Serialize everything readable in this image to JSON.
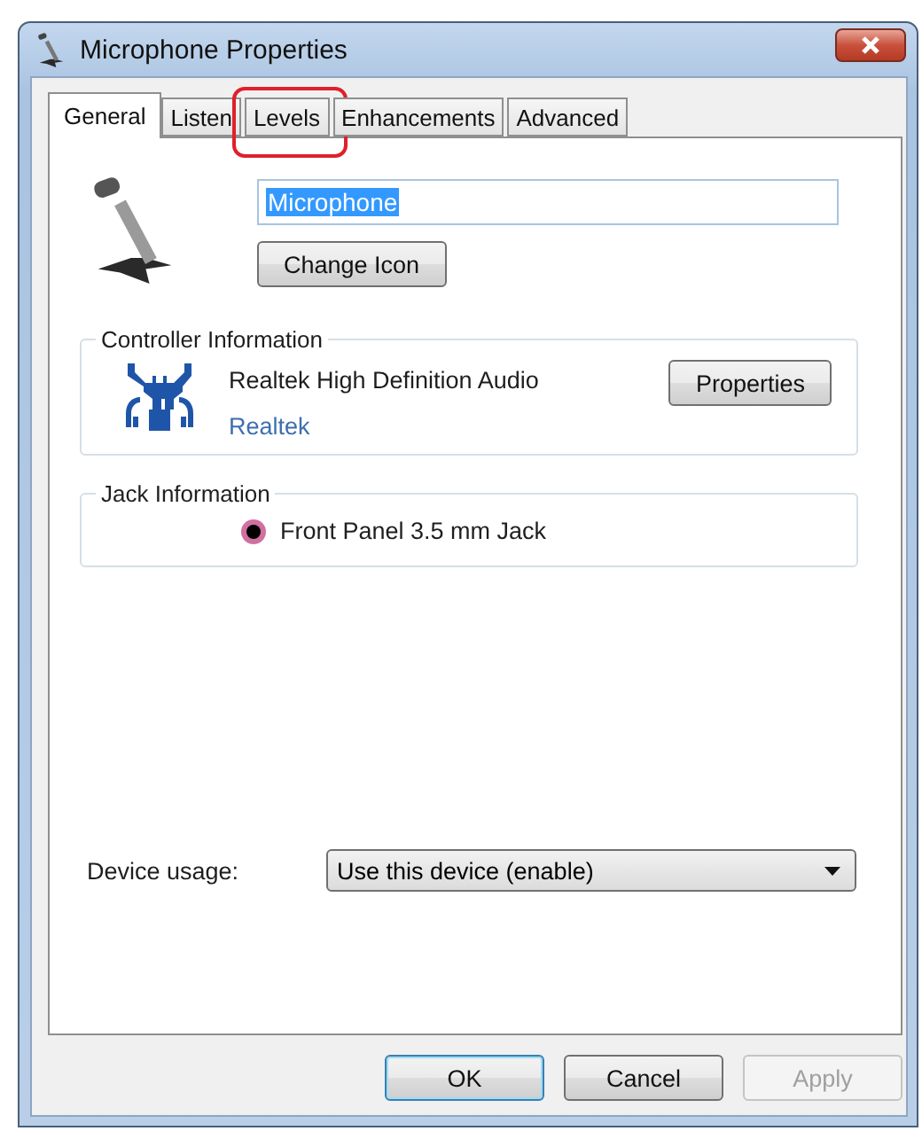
{
  "window": {
    "title": "Microphone Properties"
  },
  "tabs": [
    {
      "label": "General",
      "selected": true,
      "annotated": false
    },
    {
      "label": "Listen",
      "selected": false,
      "annotated": false
    },
    {
      "label": "Levels",
      "selected": false,
      "annotated": true
    },
    {
      "label": "Enhancements",
      "selected": false,
      "annotated": false
    },
    {
      "label": "Advanced",
      "selected": false,
      "annotated": false
    }
  ],
  "device": {
    "name": "Microphone",
    "text_selected": true,
    "change_icon_button": "Change Icon"
  },
  "controller": {
    "legend": "Controller Information",
    "name": "Realtek High Definition Audio",
    "vendor_link": "Realtek",
    "properties_button": "Properties"
  },
  "jack": {
    "legend": "Jack Information",
    "name": "Front Panel 3.5 mm Jack",
    "color": "#d070a0"
  },
  "usage": {
    "label": "Device usage:",
    "value": "Use this device (enable)"
  },
  "buttons": [
    {
      "label": "OK",
      "default": true,
      "disabled": false
    },
    {
      "label": "Cancel",
      "default": false,
      "disabled": false
    },
    {
      "label": "Apply",
      "default": false,
      "disabled": true
    }
  ]
}
